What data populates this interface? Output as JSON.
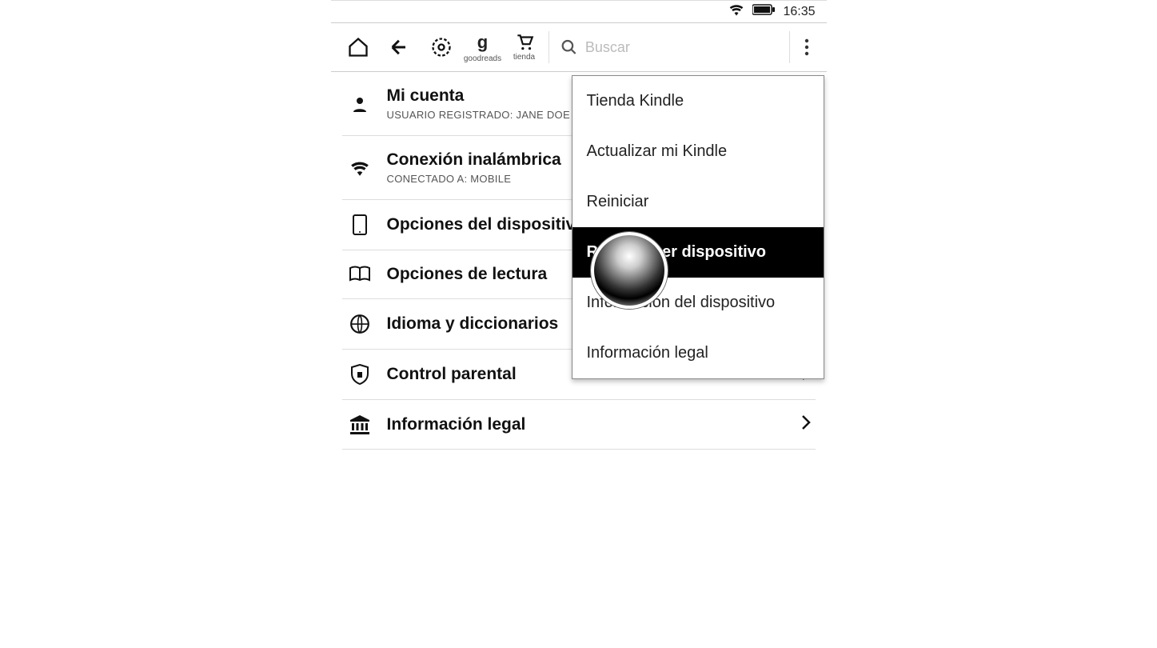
{
  "statusbar": {
    "time": "16:35"
  },
  "toolbar": {
    "goodreads_label": "goodreads",
    "store_label": "tienda",
    "search_placeholder": "Buscar"
  },
  "settings": {
    "account": {
      "title": "Mi cuenta",
      "sub": "USUARIO REGISTRADO: JANE DOE"
    },
    "wireless": {
      "title": "Conexión inalámbrica",
      "sub": "CONECTADO A: MOBILE"
    },
    "device_options": {
      "title": "Opciones del dispositivo"
    },
    "reading_options": {
      "title": "Opciones de lectura"
    },
    "language": {
      "title": "Idioma y diccionarios"
    },
    "parental": {
      "title": "Control parental"
    },
    "legal": {
      "title": "Información legal"
    }
  },
  "menu": {
    "kindle_store": "Tienda Kindle",
    "update_kindle": "Actualizar mi Kindle",
    "restart": "Reiniciar",
    "reset_device": "Restablecer dispositivo",
    "device_info": "Información del dispositivo",
    "legal_info": "Información legal"
  }
}
